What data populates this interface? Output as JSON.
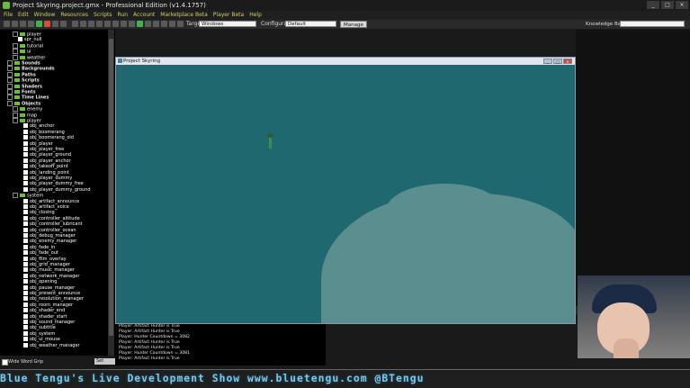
{
  "window": {
    "title": "Project Skyring.project.gmx - Professional Edition (v1.4.1757)"
  },
  "menu": [
    "File",
    "Edit",
    "Window",
    "Resources",
    "Scripts",
    "Run",
    "Account",
    "Marketplace Beta",
    "Player Beta",
    "Help"
  ],
  "toolbar": {
    "target_label": "Target",
    "target_value": "Windows",
    "config_label": "Configuration",
    "config_value": "Default",
    "manage_label": "Manage",
    "knowledge_label": "Knowledge Base"
  },
  "tree": {
    "rows": [
      {
        "label": "player",
        "type": "sprite-folder",
        "indent": 2
      },
      {
        "label": "spr_null",
        "type": "item",
        "indent": 3
      },
      {
        "label": "tutorial",
        "type": "sprite-folder",
        "indent": 2
      },
      {
        "label": "ui",
        "type": "sprite-folder",
        "indent": 2
      },
      {
        "label": "weather",
        "type": "sprite-folder",
        "indent": 2
      },
      {
        "label": "Sounds",
        "type": "cat",
        "indent": 1
      },
      {
        "label": "Backgrounds",
        "type": "cat",
        "indent": 1
      },
      {
        "label": "Paths",
        "type": "cat",
        "indent": 1
      },
      {
        "label": "Scripts",
        "type": "cat",
        "indent": 1
      },
      {
        "label": "Shaders",
        "type": "cat",
        "indent": 1
      },
      {
        "label": "Fonts",
        "type": "cat",
        "indent": 1
      },
      {
        "label": "Time Lines",
        "type": "cat",
        "indent": 1
      },
      {
        "label": "Objects",
        "type": "cat",
        "indent": 1
      },
      {
        "label": "enemy",
        "type": "sprite-folder",
        "indent": 2
      },
      {
        "label": "map",
        "type": "sprite-folder",
        "indent": 2
      },
      {
        "label": "player",
        "type": "sprite-folder",
        "indent": 2
      },
      {
        "label": "obj_anchor",
        "type": "item",
        "indent": 4
      },
      {
        "label": "obj_boomerang",
        "type": "item",
        "indent": 4
      },
      {
        "label": "obj_boomerang_old",
        "type": "item",
        "indent": 4
      },
      {
        "label": "obj_player",
        "type": "item",
        "indent": 4
      },
      {
        "label": "obj_player_free",
        "type": "item",
        "indent": 4
      },
      {
        "label": "obj_player_ground",
        "type": "item",
        "indent": 4
      },
      {
        "label": "obj_player_anchor",
        "type": "item",
        "indent": 4
      },
      {
        "label": "obj_takeoff_point",
        "type": "item",
        "indent": 4
      },
      {
        "label": "obj_landing_point",
        "type": "item",
        "indent": 4
      },
      {
        "label": "obj_player_dummy",
        "type": "item",
        "indent": 4
      },
      {
        "label": "obj_player_dummy_free",
        "type": "item",
        "indent": 4
      },
      {
        "label": "obj_player_dummy_ground",
        "type": "item",
        "indent": 4
      },
      {
        "label": "system",
        "type": "sprite-folder",
        "indent": 2
      },
      {
        "label": "obj_artifact_announce",
        "type": "item",
        "indent": 4
      },
      {
        "label": "obj_artifact_voice",
        "type": "item",
        "indent": 4
      },
      {
        "label": "obj_closing",
        "type": "item",
        "indent": 4
      },
      {
        "label": "obj_controller_altitude",
        "type": "item",
        "indent": 4
      },
      {
        "label": "obj_controller_lubricant",
        "type": "item",
        "indent": 4
      },
      {
        "label": "obj_controller_ocean",
        "type": "item",
        "indent": 4
      },
      {
        "label": "obj_debug_manager",
        "type": "item",
        "indent": 4
      },
      {
        "label": "obj_enemy_manager",
        "type": "item",
        "indent": 4
      },
      {
        "label": "obj_fade_in",
        "type": "item",
        "indent": 4
      },
      {
        "label": "obj_fade_out",
        "type": "item",
        "indent": 4
      },
      {
        "label": "obj_film_overlay",
        "type": "item",
        "indent": 4
      },
      {
        "label": "obj_grid_manager",
        "type": "item",
        "indent": 4
      },
      {
        "label": "obj_music_manager",
        "type": "item",
        "indent": 4
      },
      {
        "label": "obj_network_manager",
        "type": "item",
        "indent": 4
      },
      {
        "label": "obj_opening",
        "type": "item",
        "indent": 4
      },
      {
        "label": "obj_pause_manager",
        "type": "item",
        "indent": 4
      },
      {
        "label": "obj_present_announce",
        "type": "item",
        "indent": 4
      },
      {
        "label": "obj_resolution_manager",
        "type": "item",
        "indent": 4
      },
      {
        "label": "obj_room_manager",
        "type": "item",
        "indent": 4
      },
      {
        "label": "obj_shader_end",
        "type": "item",
        "indent": 4
      },
      {
        "label": "obj_shader_start",
        "type": "item",
        "indent": 4
      },
      {
        "label": "obj_sound_manager",
        "type": "item",
        "indent": 4
      },
      {
        "label": "obj_subtitle",
        "type": "item",
        "indent": 4
      },
      {
        "label": "obj_system",
        "type": "item",
        "indent": 4
      },
      {
        "label": "obj_ui_mouse",
        "type": "item",
        "indent": 4
      },
      {
        "label": "obj_weather_manager",
        "type": "item",
        "indent": 4
      }
    ],
    "footer_checkbox": "Wide Word Grip",
    "footer_button": "Set Table"
  },
  "game_window": {
    "title": "Project Skyring"
  },
  "output": {
    "lines": [
      "Player: Artifact Hunter is True",
      "Player: Artifact Hunter is True",
      "Player: Hunter Countdown = 3082",
      "Player: Artifact Hunter is True",
      "Player: Artifact Hunter is True",
      "Player: Hunter Countdown = 3081",
      "Player: Artifact Hunter is True"
    ]
  },
  "banner": {
    "text": "Blue Tengu's Live Development Show   www.bluetengu.com   @BTengu"
  },
  "colors": {
    "ocean": "#1f6870",
    "island": "#5b8e8f",
    "banner_text": "#7ec8e3",
    "folder": "#6dbb3b"
  }
}
